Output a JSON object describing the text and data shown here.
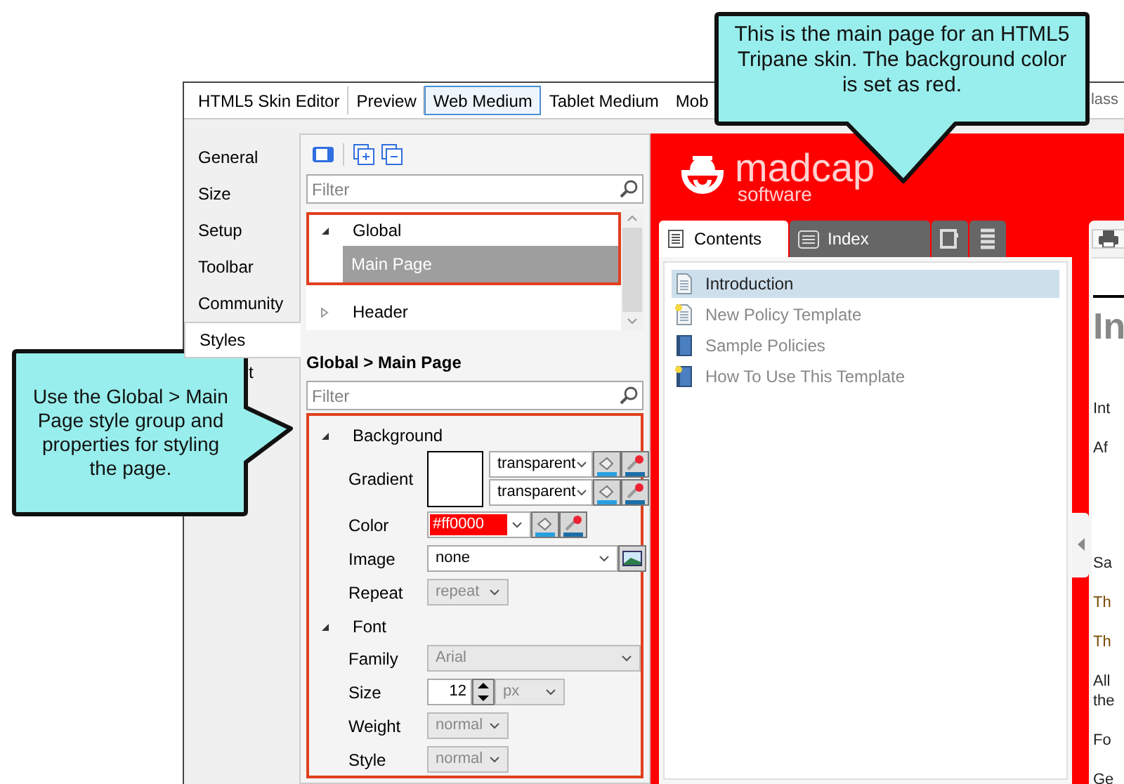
{
  "callouts": [
    {
      "text": "This is the main page for an HTML5 Tripane skin. The background color is set as red."
    },
    {
      "text": "Use the Global > Main Page style group and properties for styling the page."
    }
  ],
  "window": {
    "tabs": [
      {
        "label": "HTML5 Skin Editor",
        "selected": false
      },
      {
        "label": "Preview",
        "selected": false
      },
      {
        "label": "Web Medium",
        "selected": true
      },
      {
        "label": "Tablet Medium",
        "selected": false
      },
      {
        "label": "Mob",
        "selected": false
      }
    ],
    "tab_fragment": "lass"
  },
  "side_tabs": [
    {
      "label": "General",
      "selected": false
    },
    {
      "label": "Size",
      "selected": false
    },
    {
      "label": "Setup",
      "selected": false
    },
    {
      "label": "Toolbar",
      "selected": false
    },
    {
      "label": "Community",
      "selected": false
    },
    {
      "label": "Styles",
      "selected": true
    },
    {
      "label": "t",
      "selected": false,
      "kind": "fragment"
    }
  ],
  "styles_panel": {
    "filter": {
      "placeholder": "Filter"
    },
    "tree": [
      {
        "label": "Global",
        "expanded": true,
        "children": [
          {
            "label": "Main Page",
            "selected": true
          }
        ]
      },
      {
        "label": "Header",
        "expanded": false
      }
    ],
    "breadcrumb": "Global > Main Page",
    "properties_filter": {
      "placeholder": "Filter"
    },
    "groups": [
      {
        "label": "Background",
        "expanded": true,
        "properties": [
          {
            "kind": "gradient",
            "label": "Gradient",
            "values": [
              "transparent",
              "transparent"
            ]
          },
          {
            "kind": "color",
            "label": "Color",
            "value": "#ff0000",
            "color": "#ff0000"
          },
          {
            "kind": "image",
            "label": "Image",
            "value": "none"
          },
          {
            "kind": "select",
            "label": "Repeat",
            "value": "repeat",
            "disabled": true
          }
        ]
      },
      {
        "label": "Font",
        "expanded": true,
        "properties": [
          {
            "kind": "wide-select",
            "label": "Family",
            "value": "Arial",
            "disabled": true
          },
          {
            "kind": "number",
            "label": "Size",
            "value": "12",
            "unit": "px"
          },
          {
            "kind": "select",
            "label": "Weight",
            "value": "normal",
            "disabled": true
          },
          {
            "kind": "select",
            "label": "Style",
            "value": "normal",
            "disabled": true
          }
        ]
      }
    ]
  },
  "preview": {
    "logo": {
      "name": "madcap",
      "tagline": "software"
    },
    "tabs": [
      {
        "kind": "text",
        "label": "Contents",
        "selected": true
      },
      {
        "kind": "text",
        "label": "Index",
        "selected": false
      },
      {
        "kind": "glossary",
        "selected": false
      },
      {
        "kind": "search",
        "selected": false
      }
    ],
    "toc": [
      {
        "label": "Introduction",
        "selected": true,
        "kind": "page"
      },
      {
        "label": "New Policy Template",
        "selected": false,
        "kind": "new-page"
      },
      {
        "label": "Sample Policies",
        "selected": false,
        "kind": "book"
      },
      {
        "label": "How To Use This Template",
        "selected": false,
        "kind": "new-book"
      }
    ],
    "topic": [
      {
        "text": "In",
        "kind": "heading"
      },
      {
        "text": "Int",
        "kind": "text"
      },
      {
        "text": "Af",
        "kind": "text"
      },
      {
        "text": "Sa",
        "kind": "gap"
      },
      {
        "text": "Th",
        "kind": "brown"
      },
      {
        "text": "Th",
        "kind": "brown"
      },
      {
        "text": "All",
        "kind": "text"
      },
      {
        "text": "the",
        "kind": "tight"
      },
      {
        "text": "Fo",
        "kind": "text"
      },
      {
        "text": "Ge",
        "kind": "text"
      }
    ]
  }
}
